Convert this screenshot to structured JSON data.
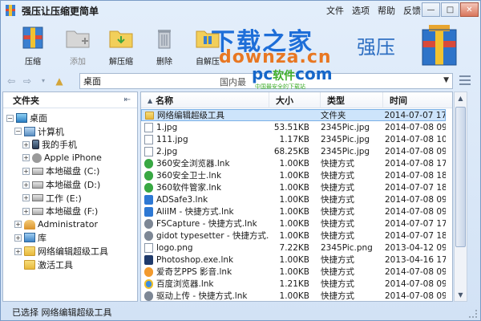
{
  "window": {
    "title": "强压让压缩更简单"
  },
  "menu": [
    "文件",
    "选项",
    "帮助",
    "反馈"
  ],
  "toolbar": {
    "compress": "压缩",
    "add": "添加",
    "extract": "解压缩",
    "delete": "删除",
    "self_extract": "自解压"
  },
  "watermark": {
    "cn": "下载之家",
    "en": "downza.cn"
  },
  "brand_label": "强压",
  "address": {
    "path": "桌面",
    "hint": "国内最",
    "pc_logo": "pc",
    "pc_logo_tail": "软件",
    "pc_logo_com": "com",
    "pc_sub": "中国最安全的下载站"
  },
  "folder_pane": {
    "header": "文件夹",
    "pin_icon": "pin-icon",
    "tree": [
      {
        "label": "桌面",
        "icon": "desktop",
        "expander": "⊟"
      },
      {
        "label": "计算机",
        "icon": "computer",
        "expander": "⊟"
      },
      {
        "label": "我的手机",
        "icon": "phone",
        "expander": "⊞"
      },
      {
        "label": "Apple iPhone",
        "icon": "apple",
        "expander": "⊞"
      },
      {
        "label": "本地磁盘 (C:)",
        "icon": "drive",
        "expander": "⊞"
      },
      {
        "label": "本地磁盘 (D:)",
        "icon": "drive",
        "expander": "⊞"
      },
      {
        "label": "工作 (E:)",
        "icon": "drive",
        "expander": "⊞"
      },
      {
        "label": "本地磁盘 (F:)",
        "icon": "drive",
        "expander": "⊞"
      },
      {
        "label": "Administrator",
        "icon": "user",
        "expander": "⊞"
      },
      {
        "label": "库",
        "icon": "library",
        "expander": "⊞"
      },
      {
        "label": "网络编辑超级工具",
        "icon": "folder",
        "expander": "⊞"
      },
      {
        "label": "激活工具",
        "icon": "folder",
        "expander": ""
      }
    ]
  },
  "file_list": {
    "columns": {
      "name": "名称",
      "size": "大小",
      "type": "类型",
      "time": "时间"
    },
    "rows": [
      {
        "name": "网络编辑超级工具",
        "size": "",
        "type": "文件夹",
        "time": "2014-07-07 17:...",
        "icon": "folder",
        "selected": true
      },
      {
        "name": "1.jpg",
        "size": "53.51KB",
        "type": "2345Pic.jpg",
        "time": "2014-07-08 09:...",
        "icon": "file"
      },
      {
        "name": "111.jpg",
        "size": "1.17KB",
        "type": "2345Pic.jpg",
        "time": "2014-07-08 10:...",
        "icon": "file"
      },
      {
        "name": "2.jpg",
        "size": "68.25KB",
        "type": "2345Pic.jpg",
        "time": "2014-07-08 09:...",
        "icon": "file"
      },
      {
        "name": "360安全浏览器.lnk",
        "size": "1.00KB",
        "type": "快捷方式",
        "time": "2014-07-08 17:...",
        "icon": "lnk-green"
      },
      {
        "name": "360安全卫士.lnk",
        "size": "1.00KB",
        "type": "快捷方式",
        "time": "2014-07-08 18:...",
        "icon": "lnk-green"
      },
      {
        "name": "360软件管家.lnk",
        "size": "1.00KB",
        "type": "快捷方式",
        "time": "2014-07-07 18:...",
        "icon": "lnk-green"
      },
      {
        "name": "ADSafe3.lnk",
        "size": "1.00KB",
        "type": "快捷方式",
        "time": "2014-07-08 09:...",
        "icon": "lnk-blue"
      },
      {
        "name": "AliIM - 快捷方式.lnk",
        "size": "1.00KB",
        "type": "快捷方式",
        "time": "2014-07-08 09:...",
        "icon": "lnk-blue"
      },
      {
        "name": "FSCapture - 快捷方式.lnk",
        "size": "1.00KB",
        "type": "快捷方式",
        "time": "2014-07-07 17:...",
        "icon": "lnk-gray"
      },
      {
        "name": "gidot typesetter - 快捷方式...",
        "size": "1.00KB",
        "type": "快捷方式",
        "time": "2014-07-07 18:...",
        "icon": "lnk-gray"
      },
      {
        "name": "logo.png",
        "size": "7.22KB",
        "type": "2345Pic.png",
        "time": "2013-04-12 09:...",
        "icon": "file"
      },
      {
        "name": "Photoshop.exe.lnk",
        "size": "1.00KB",
        "type": "快捷方式",
        "time": "2013-04-16 17:...",
        "icon": "lnk-dark"
      },
      {
        "name": "爱奇艺PPS 影音.lnk",
        "size": "1.00KB",
        "type": "快捷方式",
        "time": "2014-07-08 09:...",
        "icon": "lnk-orange"
      },
      {
        "name": "百度浏览器.lnk",
        "size": "1.21KB",
        "type": "快捷方式",
        "time": "2014-07-08 09:...",
        "icon": "lnk-ie"
      },
      {
        "name": "驱动上传 - 快捷方式.lnk",
        "size": "1.00KB",
        "type": "快捷方式",
        "time": "2014-07-08 09:...",
        "icon": "lnk-gray"
      }
    ]
  },
  "status": {
    "text": "已选择 网络编辑超级工具"
  },
  "colors": {
    "accent": "#1e6ed8",
    "selection": "#cde4fb",
    "watermark_orange": "#e87722"
  }
}
